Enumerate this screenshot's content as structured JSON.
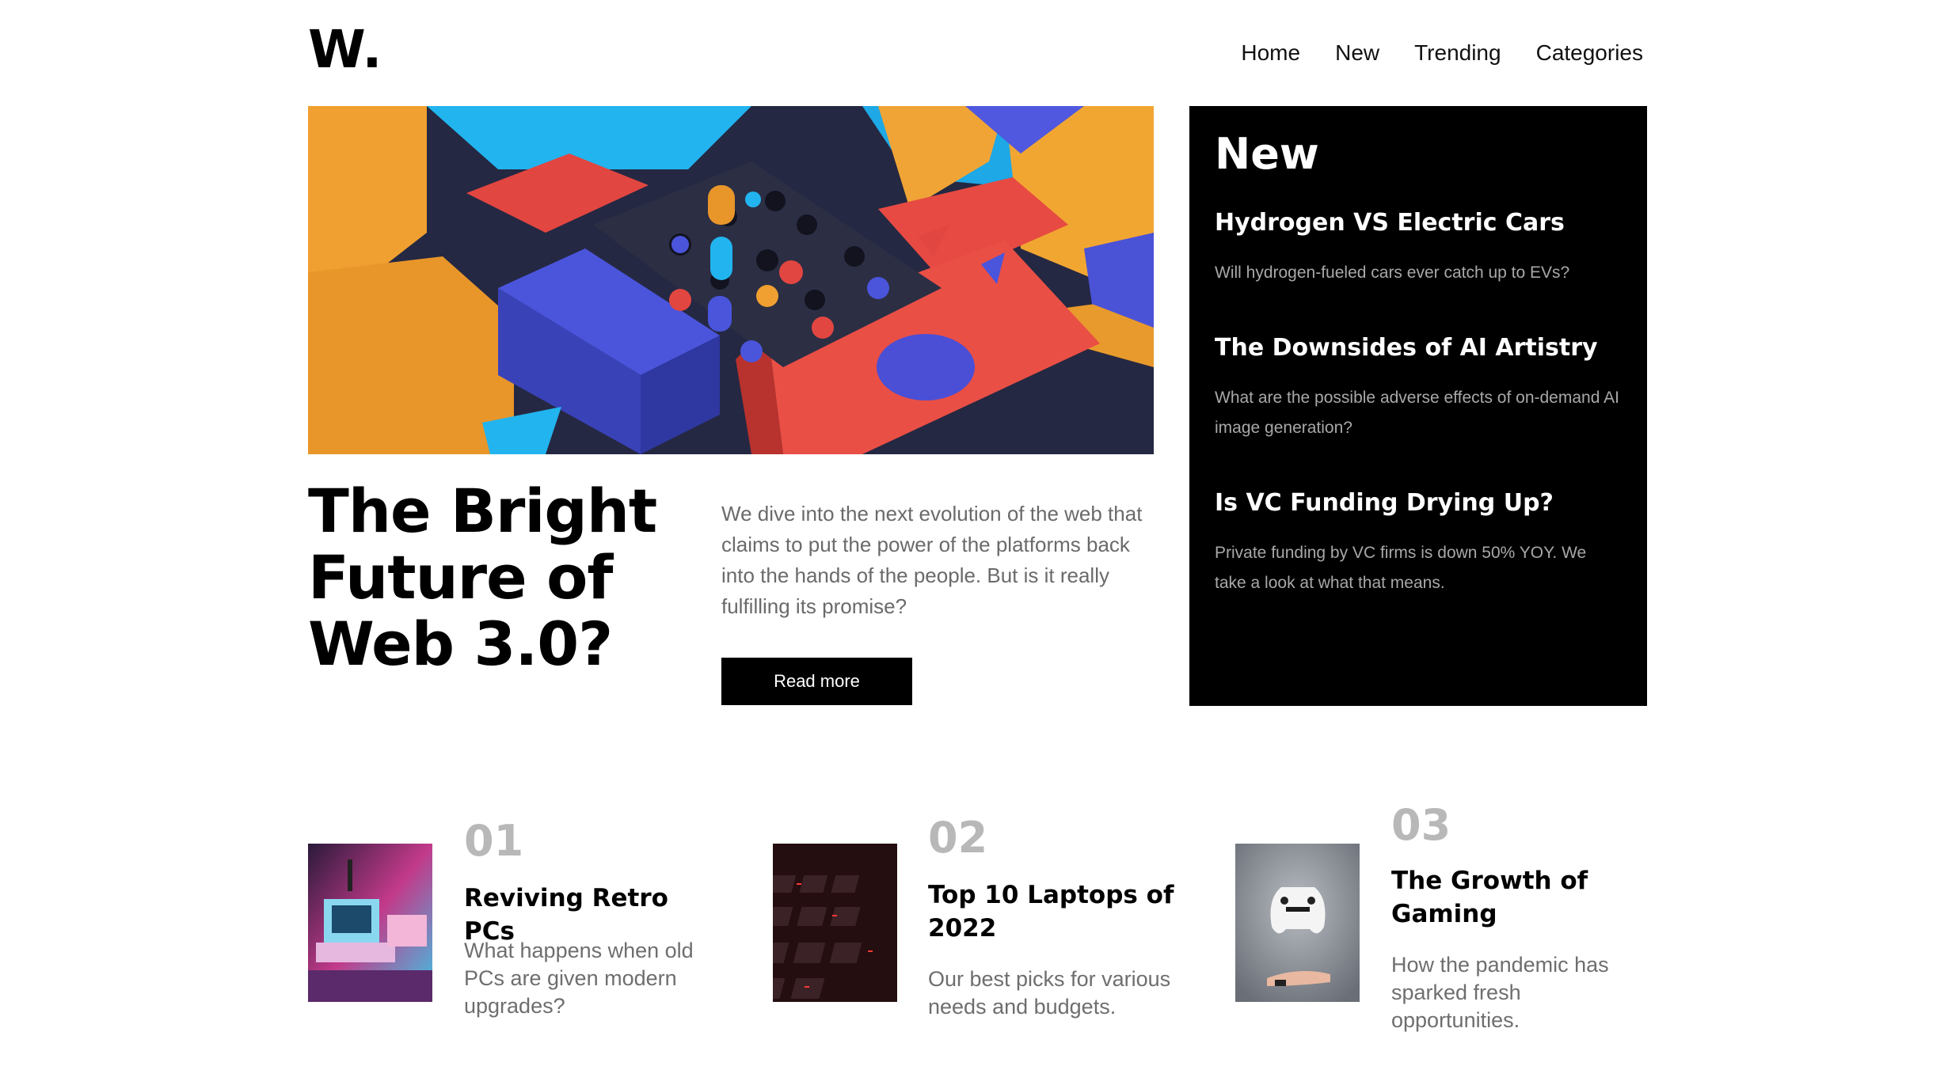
{
  "logo": "W.",
  "nav": {
    "items": [
      "Home",
      "New",
      "Trending",
      "Categories"
    ]
  },
  "hero": {
    "title": "The Bright Future of Web 3.0?",
    "description": "We dive into the next evolution of the web that claims to put the power of the platforms back into the hands of the people. But is it really fulfilling its promise?",
    "button_label": "Read more"
  },
  "new_panel": {
    "heading": "New",
    "items": [
      {
        "title": "Hydrogen VS Electric Cars",
        "description": "Will hydrogen-fueled cars ever catch up to EVs?"
      },
      {
        "title": "The Downsides of AI Artistry",
        "description": "What are the possible adverse effects of on-demand AI image generation?"
      },
      {
        "title": "Is VC Funding Drying Up?",
        "description": "Private funding by VC firms is down 50% YOY. We take a look at what that means."
      }
    ]
  },
  "articles": [
    {
      "number": "01",
      "title": "Reviving Retro PCs",
      "description": "What happens when old PCs are given modern upgrades?"
    },
    {
      "number": "02",
      "title": "Top 10 Laptops of 2022",
      "description": "Our best picks for various needs and budgets."
    },
    {
      "number": "03",
      "title": "The Growth of Gaming",
      "description": "How the pandemic has sparked fresh opportunities."
    }
  ],
  "colors": {
    "accent": "#000000",
    "muted_text": "#6a6a6a",
    "number_gray": "#b8b8b8",
    "panel_text_muted": "#a8a8a8"
  }
}
